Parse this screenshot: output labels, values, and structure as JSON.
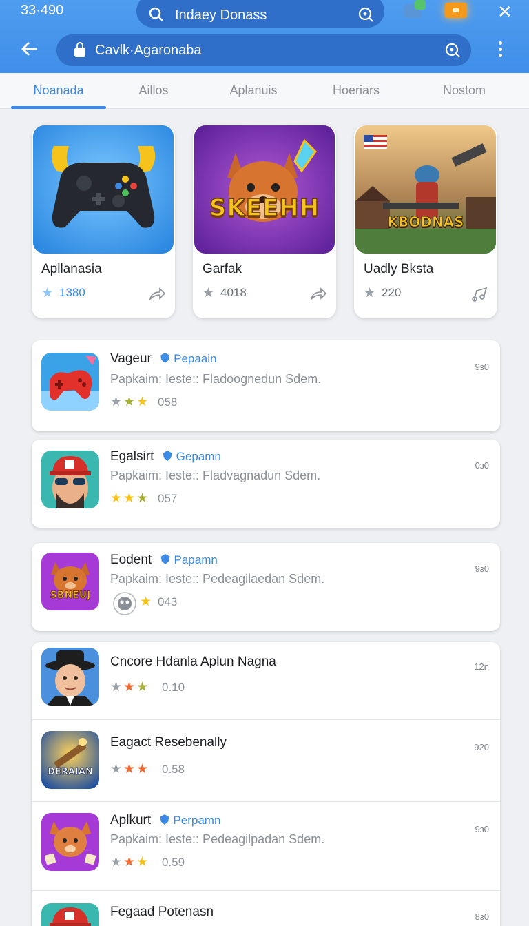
{
  "status": {
    "time": "33·490"
  },
  "top_search": {
    "text": "Indaey Donass"
  },
  "url_bar": {
    "text": "Cavlk·Agaronaba"
  },
  "tabs": [
    "Noanada",
    "Aillos",
    "Aplanuis",
    "Hoeriars",
    "Nostom"
  ],
  "featured": [
    {
      "title": "Apllanasia",
      "count": "1380",
      "art_text": ""
    },
    {
      "title": "Garfak",
      "count": "4018",
      "art_text": "SKEEHH"
    },
    {
      "title": "Uadly Bksta",
      "count": "220",
      "art_text": "KBODNAS"
    }
  ],
  "list": [
    {
      "name": "Vageur",
      "publisher": "Pepaain",
      "desc": "Papkaim: Ieste:: Fladoognedun Sdem.",
      "rating": "058",
      "size": "9з0"
    },
    {
      "name": "Egalsirt",
      "publisher": "Gepamn",
      "desc": "Papkaim: Ieste:: Fladvagnadun Sdem.",
      "rating": "057",
      "size": "0з0"
    },
    {
      "name": "Eodent",
      "publisher": "Papamn",
      "desc": "Papkaim: Ieste:: Pedeagilaedan Sdem.",
      "rating": "043",
      "size": "9з0",
      "icon_text": "SBNEUJ"
    },
    {
      "name": "Cncore Hdanla Aplun Nagna",
      "rating": "0.10",
      "size": "12n"
    },
    {
      "name": "Eagact Resebenally",
      "rating": "0.58",
      "size": "920",
      "icon_text": "DERAIAN"
    },
    {
      "name": "Aplkurt",
      "publisher": "Perpamn",
      "desc": "Papkaim: Ieste:: Pedeagilpadan Sdem.",
      "rating": "0.59",
      "size": "9з0"
    },
    {
      "name": "Fegaad Potenasn",
      "size": "8з0"
    }
  ],
  "colors": {
    "accent": "#3a8ae6",
    "topbar": "#4493ec",
    "star_yellow": "#f4c21c",
    "star_orange": "#ef6b34"
  }
}
